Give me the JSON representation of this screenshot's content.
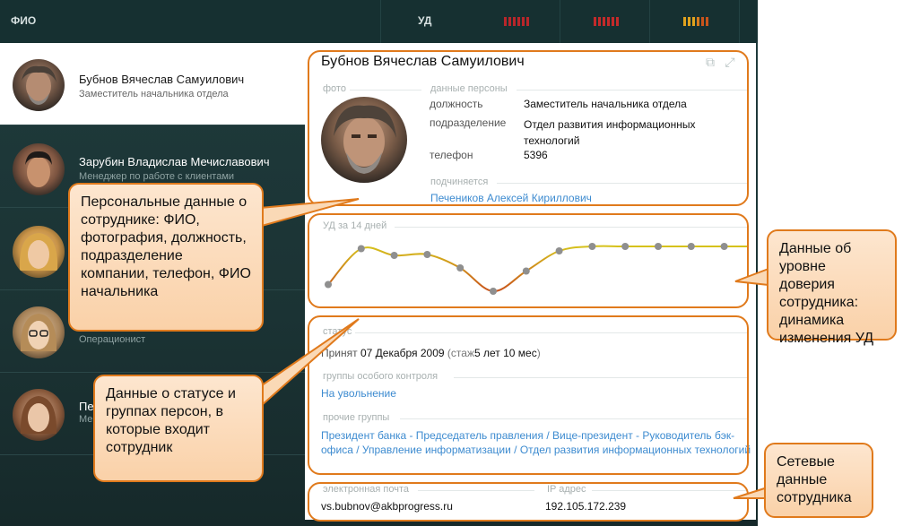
{
  "header": {
    "col_fio": "ФИО",
    "col_ud": "УД"
  },
  "employees": [
    {
      "name": "Бубнов Вячеслав Самуилович",
      "role": "Заместитель начальника отдела"
    },
    {
      "name": "Зарубин Владислав Мечиславович",
      "role": "Менеджер по работе с клиентами"
    },
    {
      "name": "",
      "role": ""
    },
    {
      "name": "",
      "role": "Операционист"
    },
    {
      "name": "Пе",
      "role": "Мен"
    }
  ],
  "detail": {
    "name": "Бубнов Вячеслав Самуилович",
    "photo_label": "фото",
    "person_data_label": "данные персоны",
    "fields": [
      {
        "key": "должность",
        "value": "Заместитель начальника отдела"
      },
      {
        "key": "подразделение",
        "value": "Отдел развития информационных технологий"
      },
      {
        "key": "телефон",
        "value": "5396"
      }
    ],
    "reports_to_label": "подчиняется",
    "reports_to": "Печеников Алексей Кириллович",
    "ud_label": "УД за 14 дней",
    "status_label": "статус",
    "status_hired_word": "Принят",
    "status_date": "07 Декабря 2009",
    "status_tenure_open": "(стаж",
    "status_tenure_value": "5 лет 10 мес",
    "status_tenure_close": ")",
    "special_groups_label": "группы особого контроля",
    "special_group": "На увольнение",
    "other_groups_label": "прочие группы",
    "other_groups": "Президент банка - Председатель правления / Вице-президент - Руководитель бэк-офиса / Управление информатизации / Отдел развития информационных технологий",
    "email_label": "электронная почта",
    "email": "vs.bubnov@akbprogress.ru",
    "ip_label": "IP адрес",
    "ip": "192.105.172.239"
  },
  "chart_data": {
    "type": "line",
    "title": "УД за 14 дней",
    "x": [
      1,
      2,
      3,
      4,
      5,
      6,
      7,
      8,
      9,
      10,
      11,
      12,
      13
    ],
    "values": [
      0.15,
      0.95,
      0.8,
      0.82,
      0.52,
      0.0,
      0.45,
      0.9,
      1.0,
      1.0,
      1.0,
      1.0,
      1.0
    ],
    "ylim": [
      0,
      1
    ],
    "grid": false,
    "colors": {
      "high": "#d6c21c",
      "low": "#c9541c",
      "point": "#8f8f8f"
    }
  },
  "callouts": {
    "personal": "Персональные данные о сотруднике: ФИО, фотография, должность, подразделение компании, телефон, ФИО начальника",
    "trust": "Данные об уровне доверия сотрудника: динамика изменения УД",
    "status": "Данные о статусе и группах персон, в которые входит сотрудник",
    "network": "Сетевые данные сотрудника"
  },
  "colors": {
    "accent": "#e07a1c",
    "link": "#3d8bd0",
    "app_bg": "#1b3334"
  }
}
